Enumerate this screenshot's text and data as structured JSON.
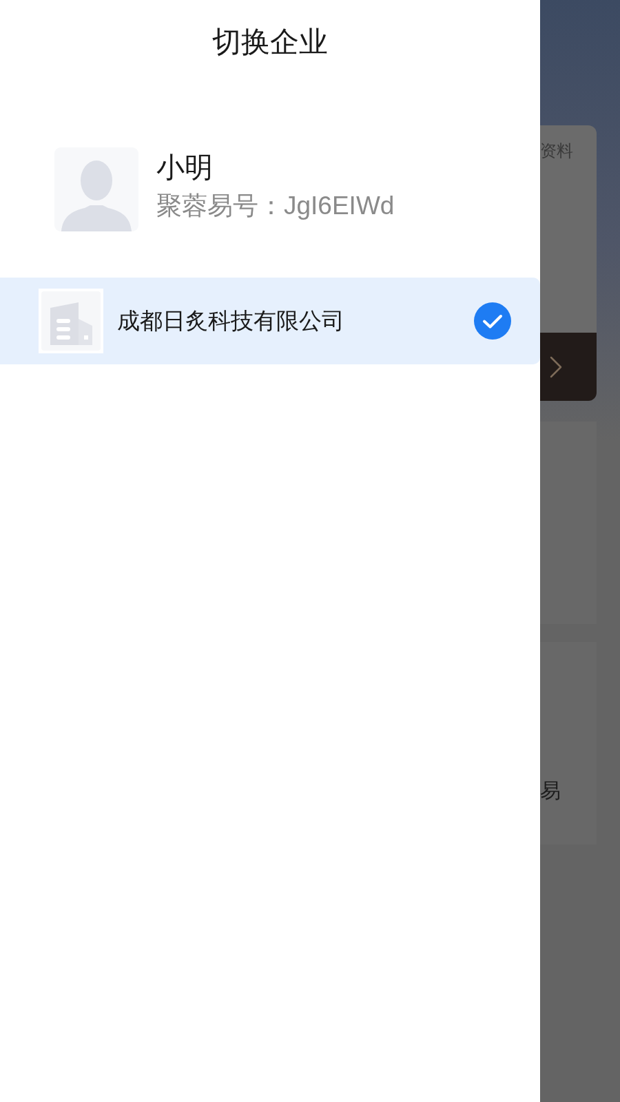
{
  "drawer": {
    "title": "切换企业",
    "user": {
      "name": "小明",
      "account": "聚蓉易号：JgI6EIWd"
    },
    "companies": [
      {
        "name": "成都日炙科技有限公司",
        "selected": true
      }
    ]
  },
  "background_page": {
    "cards": [
      {
        "kind": "info",
        "label": "资料"
      },
      {
        "kind": "action"
      },
      {
        "kind": "tile"
      },
      {
        "kind": "tile",
        "label": "易"
      }
    ]
  }
}
